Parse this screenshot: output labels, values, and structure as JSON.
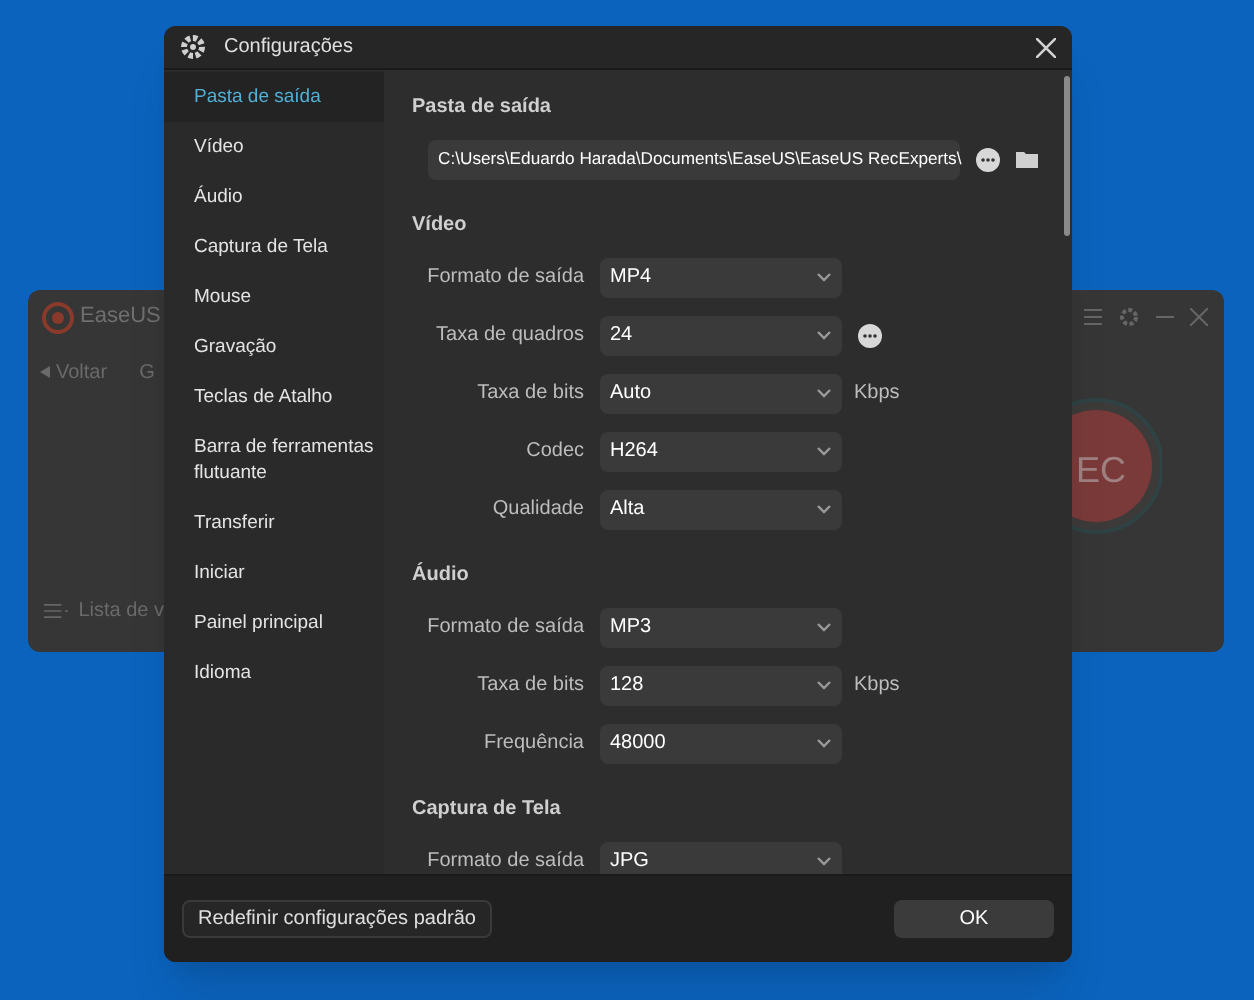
{
  "background_app": {
    "title": "EaseUS",
    "back": "Voltar",
    "tab": "G",
    "list": "Lista de v",
    "rec": "EC"
  },
  "window": {
    "title": "Configurações"
  },
  "sidebar": {
    "items": [
      {
        "label": "Pasta de saída",
        "selected": true
      },
      {
        "label": "Vídeo",
        "selected": false
      },
      {
        "label": "Áudio",
        "selected": false
      },
      {
        "label": "Captura de Tela",
        "selected": false
      },
      {
        "label": "Mouse",
        "selected": false
      },
      {
        "label": "Gravação",
        "selected": false
      },
      {
        "label": "Teclas de Atalho",
        "selected": false
      },
      {
        "label": "Barra de ferramentas flutuante",
        "selected": false
      },
      {
        "label": "Transferir",
        "selected": false
      },
      {
        "label": "Iniciar",
        "selected": false
      },
      {
        "label": "Painel principal",
        "selected": false
      },
      {
        "label": "Idioma",
        "selected": false
      }
    ]
  },
  "sections": [
    {
      "title": "Pasta de saída",
      "rows": [
        {
          "kind": "path",
          "value": "C:\\Users\\Eduardo Harada\\Documents\\EaseUS\\EaseUS RecExperts\\"
        }
      ]
    },
    {
      "title": "Vídeo",
      "rows": [
        {
          "kind": "select",
          "label": "Formato de saída",
          "value": "MP4",
          "more": false
        },
        {
          "kind": "select",
          "label": "Taxa de quadros",
          "value": "24",
          "more": true
        },
        {
          "kind": "select",
          "label": "Taxa de bits",
          "value": "Auto",
          "unit": "Kbps",
          "more": false
        },
        {
          "kind": "select",
          "label": "Codec",
          "value": "H264",
          "more": false
        },
        {
          "kind": "select",
          "label": "Qualidade",
          "value": "Alta",
          "more": false
        }
      ]
    },
    {
      "title": "Áudio",
      "rows": [
        {
          "kind": "select",
          "label": "Formato de saída",
          "value": "MP3",
          "more": false
        },
        {
          "kind": "select",
          "label": "Taxa de bits",
          "value": "128",
          "unit": "Kbps",
          "more": false
        },
        {
          "kind": "select",
          "label": "Frequência",
          "value": "48000",
          "more": false
        }
      ]
    },
    {
      "title": "Captura de Tela",
      "rows": [
        {
          "kind": "select",
          "label": "Formato de saída",
          "value": "JPG",
          "more": false
        }
      ]
    }
  ],
  "footer": {
    "reset": "Redefinir configurações padrão",
    "ok": "OK"
  }
}
